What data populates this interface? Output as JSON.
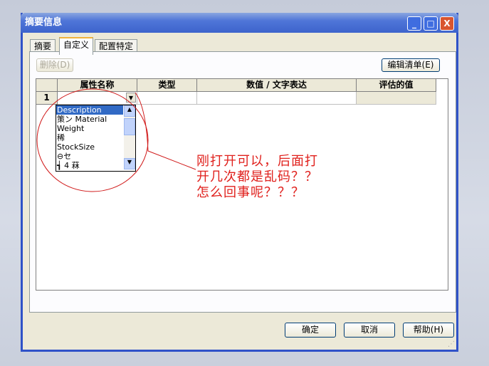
{
  "window": {
    "title": "摘要信息",
    "minimize": "_",
    "maximize": "□",
    "close": "X"
  },
  "tabs": [
    "摘要",
    "自定义",
    "配置特定"
  ],
  "buttons": {
    "delete": "删除(D)",
    "edit_list": "编辑清单(E)",
    "ok": "确定",
    "cancel": "取消",
    "help": "帮助(H)"
  },
  "grid": {
    "headers": [
      "属性名称",
      "类型",
      "数值 / 文字表达",
      "评估的值"
    ],
    "rows": [
      {
        "num": "1",
        "name": "",
        "type": "",
        "value": "",
        "evaluated": ""
      }
    ]
  },
  "dropdown": {
    "items": [
      "Description",
      "策ン  Material",
      "Weight",
      "  稀",
      "StockSize",
      "⊖セ",
      "   ┪ 4      菻"
    ],
    "selected": "Description"
  },
  "annotation": {
    "lines": [
      "刚打开可以，后面打",
      "开几次都是乱码？？",
      "怎么回事呢？？？"
    ]
  },
  "colors": {
    "annotation": "#e0201c",
    "title_bar": "#3d64cc",
    "selection": "#316ac5"
  }
}
